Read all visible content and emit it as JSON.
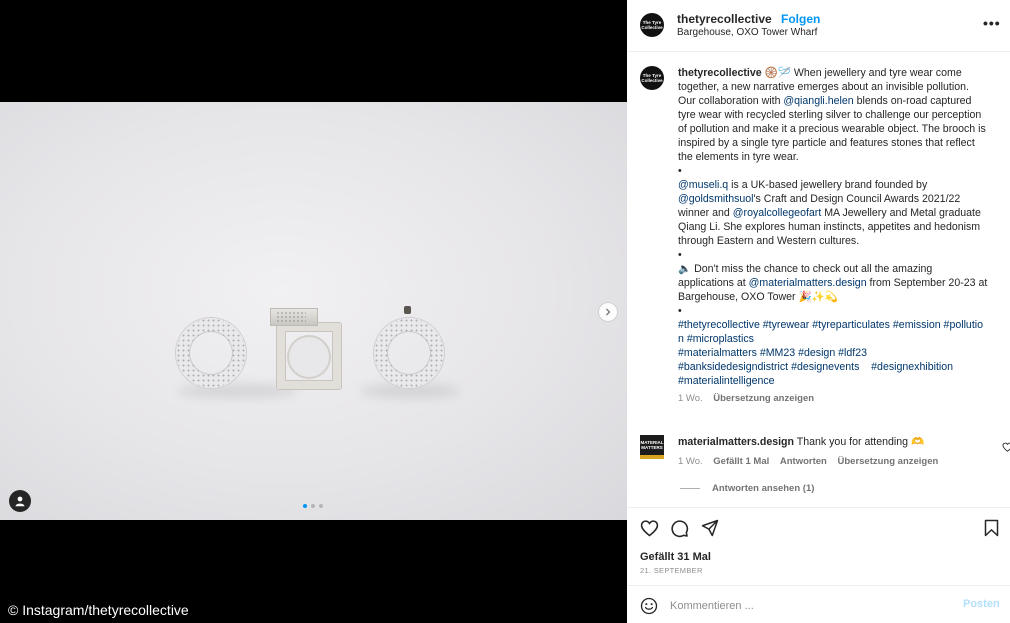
{
  "post": {
    "username": "thetyrecollective",
    "avatar_text": "The Tyre Collective",
    "follow_label": "Folgen",
    "location": "Bargehouse, OXO Tower Wharf",
    "more_label": "•••"
  },
  "caption": {
    "username": "thetyrecollective",
    "emoji": "🛞🪡",
    "p1_text1": " When jewellery and tyre wear come together, a new narrative emerges about an invisible pollution. Our collaboration with ",
    "p1_link": "@qiangli.helen",
    "p1_text2": " blends on-road captured tyre wear with recycled sterling silver to challenge our perception of pollution and make it a precious wearable object. The brooch is inspired by a single tyre particle and features stones that reflect the elements in tyre wear.",
    "bullet": "•",
    "p2_link1": "@museli.q",
    "p2_text1": " is a UK-based jewellery brand founded by ",
    "p2_link2": "@goldsmithsuol",
    "p2_text2": "'s Craft and Design Council Awards 2021/22 winner and ",
    "p2_link3": "@royalcollegeofart",
    "p2_text3": " MA Jewellery and Metal graduate Qiang Li. She explores human instincts, appetites and hedonism through Eastern and Western cultures.",
    "p3_text1": "🔈 Don't miss the chance to check out all the amazing applications at ",
    "p3_link": "@materialmatters.design",
    "p3_text2": " from September 20-23 at Bargehouse, OXO Tower 🎉✨💫",
    "hashtags_line1": "#thetyrecollective #tyrewear #tyreparticulates #emission #pollution #microplastics",
    "hashtags_line2": "#materialmatters #MM23 #design #ldf23",
    "hashtags_line3": "#banksidedesigndistrict #designevents    #designexhibition",
    "hashtags_line4": "#materialintelligence",
    "time": "1 Wo.",
    "translate": "Übersetzung anzeigen"
  },
  "comment": {
    "avatar_text": "MATERIAL MATTERS",
    "username": "materialmatters.design",
    "text": " Thank you for attending 🫶",
    "time": "1 Wo.",
    "likes": "Gefällt 1 Mal",
    "reply": "Antworten",
    "translate": "Übersetzung anzeigen",
    "view_replies": "Antworten ansehen (1)"
  },
  "footer": {
    "likes": "Gefällt 31 Mal",
    "date": "21. SEPTEMBER",
    "comment_placeholder": "Kommentieren ...",
    "post_label": "Posten"
  },
  "media": {
    "credit": "© Instagram/thetyrecollective",
    "carousel_count": 3,
    "carousel_active": 1
  },
  "colors": {
    "accent": "#0095f6",
    "link": "#00376b",
    "post_disabled": "#b2dffc"
  }
}
